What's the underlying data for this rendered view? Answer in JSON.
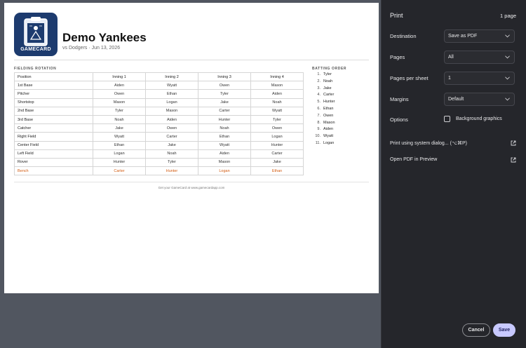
{
  "document": {
    "logo_text": "GAMECARD",
    "team": "Demo Yankees",
    "subtitle": "vs Dodgers · Jun 13, 2026",
    "fielding_label": "FIELDING ROTATION",
    "batting_label": "BATTING ORDER",
    "headers": [
      "Position",
      "Inning 1",
      "Inning 2",
      "Inning 3",
      "Inning 4"
    ],
    "rows": [
      {
        "position": "1st Base",
        "innings": [
          "Aiden",
          "Wyatt",
          "Owen",
          "Mason"
        ]
      },
      {
        "position": "Pitcher",
        "innings": [
          "Owen",
          "Ethan",
          "Tyler",
          "Aiden"
        ]
      },
      {
        "position": "Shortstop",
        "innings": [
          "Mason",
          "Logan",
          "Jake",
          "Noah"
        ]
      },
      {
        "position": "2nd Base",
        "innings": [
          "Tyler",
          "Mason",
          "Carter",
          "Wyatt"
        ]
      },
      {
        "position": "3rd Base",
        "innings": [
          "Noah",
          "Aiden",
          "Hunter",
          "Tyler"
        ]
      },
      {
        "position": "Catcher",
        "innings": [
          "Jake",
          "Owen",
          "Noah",
          "Owen"
        ]
      },
      {
        "position": "Right Field",
        "innings": [
          "Wyatt",
          "Carter",
          "Ethan",
          "Logan"
        ]
      },
      {
        "position": "Center Field",
        "innings": [
          "Ethan",
          "Jake",
          "Wyatt",
          "Hunter"
        ]
      },
      {
        "position": "Left Field",
        "innings": [
          "Logan",
          "Noah",
          "Aiden",
          "Carter"
        ]
      },
      {
        "position": "Rover",
        "innings": [
          "Hunter",
          "Tyler",
          "Mason",
          "Jake"
        ]
      },
      {
        "position": "Bench",
        "innings": [
          "Carter",
          "Hunter",
          "Logan",
          "Ethan"
        ]
      }
    ],
    "batting": [
      {
        "num": "1.",
        "name": "Tyler"
      },
      {
        "num": "2.",
        "name": "Noah"
      },
      {
        "num": "3.",
        "name": "Jake"
      },
      {
        "num": "4.",
        "name": "Carter"
      },
      {
        "num": "5.",
        "name": "Hunter"
      },
      {
        "num": "6.",
        "name": "Ethan"
      },
      {
        "num": "7.",
        "name": "Owen"
      },
      {
        "num": "8.",
        "name": "Mason"
      },
      {
        "num": "9.",
        "name": "Aiden"
      },
      {
        "num": "10.",
        "name": "Wyatt"
      },
      {
        "num": "11.",
        "name": "Logan"
      }
    ],
    "footer": "Get your GameCard at www.gamecardapp.com",
    "bench_color": "#d35c12"
  },
  "panel": {
    "title": "Print",
    "page_count": "1 page",
    "destination_label": "Destination",
    "destination_value": "Save as PDF",
    "pages_label": "Pages",
    "pages_value": "All",
    "pps_label": "Pages per sheet",
    "pps_value": "1",
    "margins_label": "Margins",
    "margins_value": "Default",
    "options_label": "Options",
    "background_graphics_label": "Background graphics",
    "background_graphics_checked": false,
    "system_dialog_label": "Print using system dialog... (⌥⌘P)",
    "open_pdf_label": "Open PDF in Preview",
    "cancel_label": "Cancel",
    "save_label": "Save",
    "accent": "#c8c9ff"
  }
}
